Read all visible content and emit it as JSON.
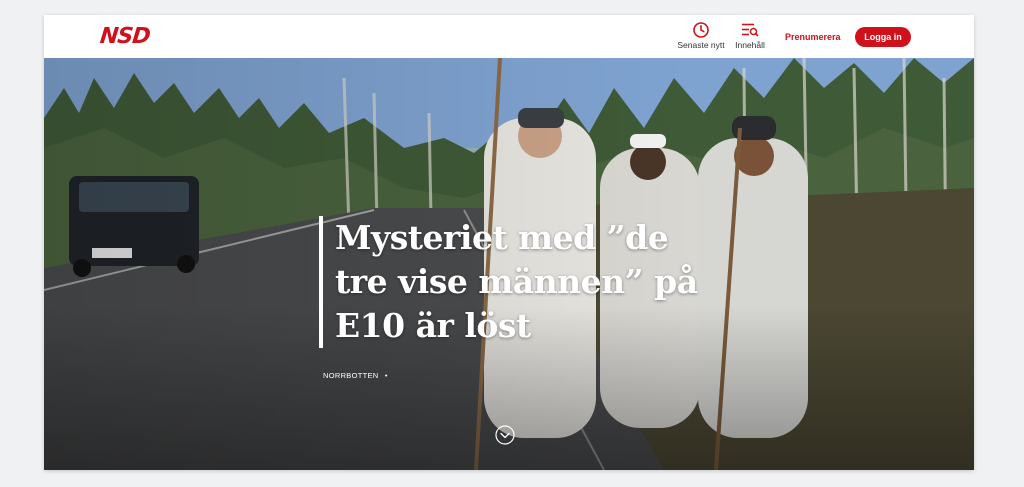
{
  "header": {
    "logo": "NSD",
    "latest_label": "Senaste nytt",
    "latest_icon": "clock-icon",
    "content_label": "Innehåll",
    "content_icon": "menu-search-icon",
    "subscribe_label": "Prenumerera",
    "login_label": "Logga in"
  },
  "hero": {
    "headline": "Mysteriet med ”de tre vise männen” på E10 är löst",
    "section": "NORRBOTTEN",
    "section_separator": "•",
    "scroll_icon": "chevron-down-circle-icon"
  },
  "colors": {
    "brand": "#d0111b",
    "background": "#f0f1f3"
  }
}
